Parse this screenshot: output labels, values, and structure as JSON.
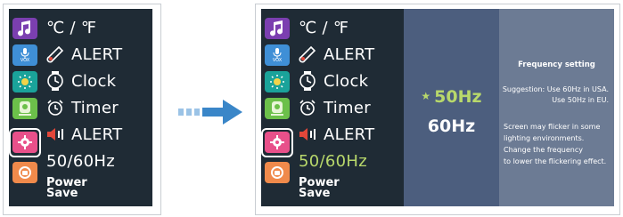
{
  "left_screen": {
    "menu": [
      {
        "label": "℃ / ℉",
        "icon": "temperature-unit"
      },
      {
        "label": "ALERT",
        "icon": "temperature-alert-icon"
      },
      {
        "label": "Clock",
        "icon": "clock-icon"
      },
      {
        "label": "Timer",
        "icon": "alarm-clock-icon"
      },
      {
        "label": "ALERT",
        "icon": "speaker-alert-icon"
      },
      {
        "label": "50/60Hz",
        "icon": ""
      }
    ],
    "power_save": [
      "Power",
      "Save"
    ],
    "sidebar_icons": [
      "music-note-icon",
      "vox-microphone-icon",
      "brightness-icon",
      "display-icon",
      "gear-icon",
      "power-save-icon"
    ],
    "vox_label": "VOX"
  },
  "right_screen": {
    "menu": [
      {
        "label": "℃ / ℉"
      },
      {
        "label": "ALERT"
      },
      {
        "label": "Clock"
      },
      {
        "label": "Timer"
      },
      {
        "label": "ALERT"
      },
      {
        "label": "50/60Hz"
      }
    ],
    "power_save": [
      "Power",
      "Save"
    ],
    "selected_item": "50/60Hz",
    "vox_label": "VOX"
  },
  "frequency_options": {
    "star": "★",
    "selected": "50Hz",
    "other": "60Hz"
  },
  "info_panel": {
    "title": "Frequency setting",
    "suggestion_line1": "Suggestion: Use 60Hz in USA.",
    "suggestion_line2": "Use 50Hz in EU.",
    "note_line1": "Screen may flicker in some",
    "note_line2": "lighting environments.",
    "note_line3": "Change the frequency",
    "note_line4": "to lower the flickering effect."
  },
  "colors": {
    "screen_bg": "#1f2b35",
    "freq_bg": "#4c5e7e",
    "info_bg": "#6c7b94",
    "selected_text": "#b8d86b",
    "caret": "#f5c400",
    "arrow": "#3a86c8"
  }
}
